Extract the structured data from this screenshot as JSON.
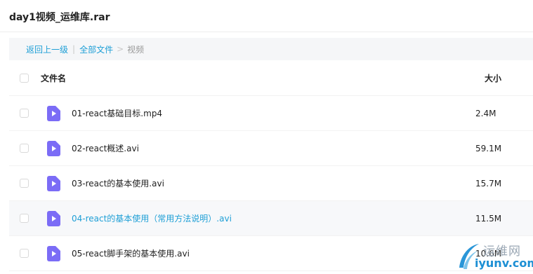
{
  "header": {
    "title": "day1视频_运维库.rar"
  },
  "breadcrumb": {
    "back_label": "返回上一级",
    "separator_bar": "|",
    "all_files_label": "全部文件",
    "separator_arrow": ">",
    "current_label": "视频"
  },
  "table": {
    "col_name_label": "文件名",
    "col_size_label": "大小",
    "rows": [
      {
        "name": "01-react基础目标.mp4",
        "size": "2.4M",
        "icon": "video-file-icon"
      },
      {
        "name": "02-react概述.avi",
        "size": "59.1M",
        "icon": "video-file-icon"
      },
      {
        "name": "03-react的基本使用.avi",
        "size": "15.7M",
        "icon": "video-file-icon"
      },
      {
        "name": "04-react的基本使用（常用方法说明）.avi",
        "size": "11.5M",
        "icon": "video-file-icon",
        "highlighted": true
      },
      {
        "name": "05-react脚手架的基本使用.avi",
        "size": "10.6M",
        "icon": "video-file-icon"
      }
    ]
  },
  "watermark": {
    "text_cn": "运维网",
    "text_en": "iyunv.com"
  },
  "colors": {
    "link": "#1e9fd6",
    "icon": "#7b6cf6",
    "breadcrumb_bg": "#f5f6f8"
  }
}
